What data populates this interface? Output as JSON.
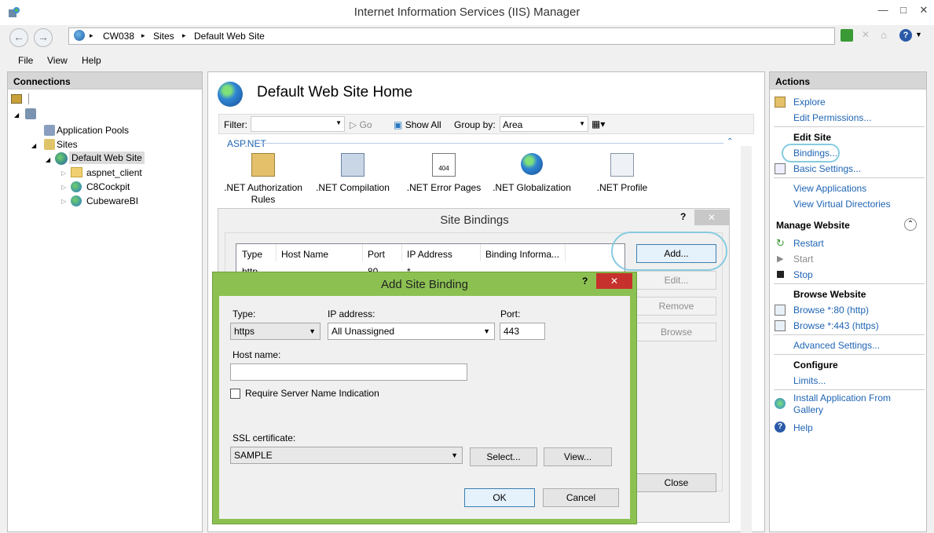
{
  "window": {
    "title": "Internet Information Services (IIS) Manager"
  },
  "address": {
    "segments": [
      "CW038",
      "Sites",
      "Default Web Site"
    ],
    "sep": "▸"
  },
  "menu": [
    "File",
    "View",
    "Help"
  ],
  "connections": {
    "header": "Connections",
    "tree": [
      "Application Pools",
      "Sites",
      "Default Web Site",
      "aspnet_client",
      "C8Cockpit",
      "CubewareBI"
    ]
  },
  "home": {
    "title": "Default Web Site Home",
    "filter_label": "Filter:",
    "go": "Go",
    "show_all": "Show All",
    "group_by": "Group by:",
    "group_value": "Area",
    "section": "ASP.NET",
    "features": [
      ".NET Authorization Rules",
      ".NET Compilation",
      ".NET Error Pages",
      ".NET Globalization",
      ".NET Profile"
    ]
  },
  "bindings": {
    "title": "Site Bindings",
    "help": "?",
    "columns": [
      "Type",
      "Host Name",
      "Port",
      "IP Address",
      "Binding Informa..."
    ],
    "row": {
      "type": "http",
      "port": "80",
      "ip": "*"
    },
    "buttons": {
      "add": "Add...",
      "edit": "Edit...",
      "remove": "Remove",
      "browse": "Browse",
      "close": "Close"
    }
  },
  "add_binding": {
    "title": "Add Site Binding",
    "help": "?",
    "type_label": "Type:",
    "type_value": "https",
    "ip_label": "IP address:",
    "ip_value": "All Unassigned",
    "port_label": "Port:",
    "port_value": "443",
    "host_label": "Host name:",
    "host_value": "",
    "sni_label": "Require Server Name Indication",
    "ssl_label": "SSL certificate:",
    "ssl_value": "SAMPLE",
    "select": "Select...",
    "view": "View...",
    "ok": "OK",
    "cancel": "Cancel"
  },
  "actions": {
    "header": "Actions",
    "explore": "Explore",
    "edit_permissions": "Edit Permissions...",
    "edit_site": "Edit Site",
    "bindings": "Bindings...",
    "basic_settings": "Basic Settings...",
    "view_apps": "View Applications",
    "view_vdirs": "View Virtual Directories",
    "manage": "Manage Website",
    "restart": "Restart",
    "start": "Start",
    "stop": "Stop",
    "browse_website": "Browse Website",
    "browse80": "Browse *:80 (http)",
    "browse443": "Browse *:443 (https)",
    "advanced": "Advanced Settings...",
    "configure": "Configure",
    "limits": "Limits...",
    "install": "Install Application From Gallery",
    "help": "Help"
  },
  "colors": {
    "accent": "#1e64b4",
    "dialog_frame": "#8cc152",
    "close_red": "#c7312d",
    "highlight_ring": "#86cbe0"
  }
}
